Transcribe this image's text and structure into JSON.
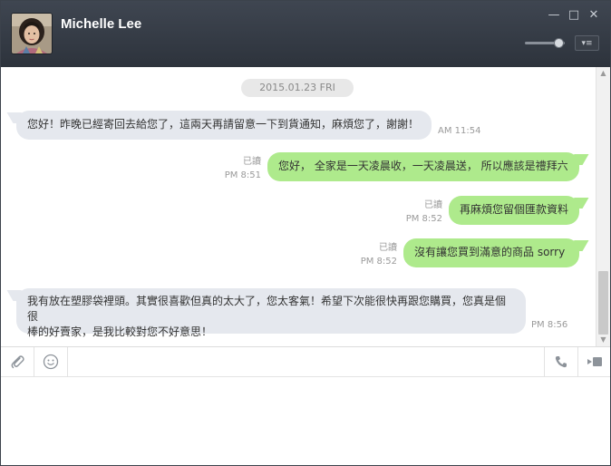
{
  "window": {
    "contact_name": "Michelle Lee",
    "controls": {
      "minimize": "—",
      "maximize": "□",
      "close": "✕"
    },
    "volume_level": 0.85,
    "menu_icon": "▾≡"
  },
  "chat": {
    "date_label": "2015.01.23 FRI",
    "messages": [
      {
        "direction": "in",
        "text": "您好！昨晚已經寄回去給您了，這兩天再請留意一下到貨通知，麻煩您了，謝謝！",
        "time": "AM 11:54"
      },
      {
        "direction": "out",
        "text": "您好， 全家是一天凌晨收，一天凌晨送， 所以應該是禮拜六",
        "read": "已讀",
        "time": "PM 8:51"
      },
      {
        "direction": "out",
        "text": "再麻煩您留個匯款資料",
        "read": "已讀",
        "time": "PM 8:52"
      },
      {
        "direction": "out",
        "text": "沒有讓您買到滿意的商品  sorry",
        "read": "已讀",
        "time": "PM 8:52"
      },
      {
        "direction": "in",
        "text_line1": "我有放在塑膠袋裡頭。其實很喜歡但真的太大了，您太客氣！希望下次能很快再跟您購買，您真是個很",
        "text_line2": "棒的好賣家，是我比較對您不好意思！",
        "time": "PM 8:56"
      }
    ]
  },
  "toolbar": {
    "attach_icon": "paperclip-icon",
    "emoji_icon": "smiley-icon",
    "call_icon": "phone-icon",
    "video_icon": "video-icon"
  },
  "input": {
    "value": "",
    "placeholder": ""
  },
  "colors": {
    "header_bg": "#353b45",
    "bubble_in": "#e5e8ee",
    "bubble_out": "#aeea8c",
    "meta_text": "#9a9a9a"
  }
}
